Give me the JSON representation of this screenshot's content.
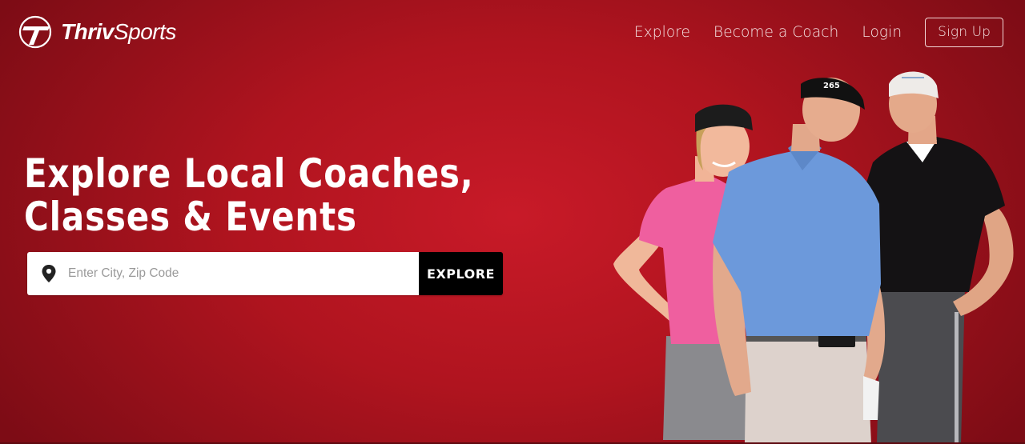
{
  "brand": {
    "name_bold": "Thriv",
    "name_light": "Sports"
  },
  "nav": {
    "explore": "Explore",
    "become_coach": "Become a Coach",
    "login": "Login",
    "signup": "Sign Up"
  },
  "hero": {
    "headline_line1": "Explore Local Coaches,",
    "headline_line2": "Classes & Events"
  },
  "search": {
    "placeholder": "Enter City, Zip Code",
    "button_label": "EXPLORE"
  },
  "coaches_image": {
    "cap_text_middle": "265",
    "icons": [
      "location-pin-icon",
      "thriv-logo-icon"
    ]
  },
  "colors": {
    "hero_red": "#b0141f",
    "button_black": "#000000",
    "pink_shirt": "#ef5f9f",
    "blue_shirt": "#6c99db",
    "black_shirt": "#141214"
  }
}
